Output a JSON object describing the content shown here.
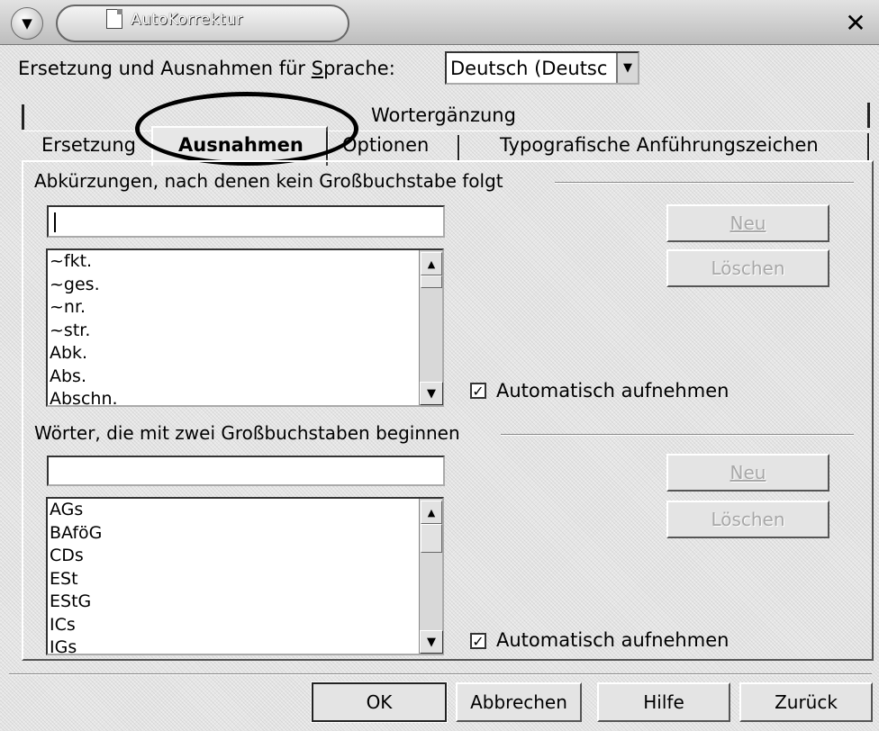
{
  "window": {
    "title": "AutoKorrektur"
  },
  "language": {
    "label": "Ersetzung und Ausnahmen für Sprache:",
    "value": "Deutsch (Deutsc"
  },
  "tabs": {
    "row_back": [
      "Wortergänzung"
    ],
    "row_front": [
      "Ersetzung",
      "Ausnahmen",
      "Optionen",
      "Typografische Anführungszeichen"
    ],
    "active": "Ausnahmen"
  },
  "abbreviations": {
    "title": "Abkürzungen, nach denen kein Großbuchstabe folgt",
    "input_value": "",
    "items": [
      "~fkt.",
      "~ges.",
      "~nr.",
      "~str.",
      "Abk.",
      "Abs.",
      "Abschn."
    ],
    "new_label": "Neu",
    "delete_label": "Löschen",
    "autoinclude_label": "Automatisch aufnehmen",
    "autoinclude_checked": true
  },
  "two_caps": {
    "title": "Wörter, die mit zwei Großbuchstaben beginnen",
    "input_value": "",
    "items": [
      "AGs",
      "BAföG",
      "CDs",
      "ESt",
      "EStG",
      "ICs",
      "IGs"
    ],
    "new_label": "Neu",
    "delete_label": "Löschen",
    "autoinclude_label": "Automatisch aufnehmen",
    "autoinclude_checked": true
  },
  "footer": {
    "ok": "OK",
    "cancel": "Abbrechen",
    "help": "Hilfe",
    "back": "Zurück"
  },
  "icons": {
    "menu": "menu-down-icon",
    "document": "document-icon",
    "close": "close-icon",
    "check": "checkmark-icon"
  }
}
